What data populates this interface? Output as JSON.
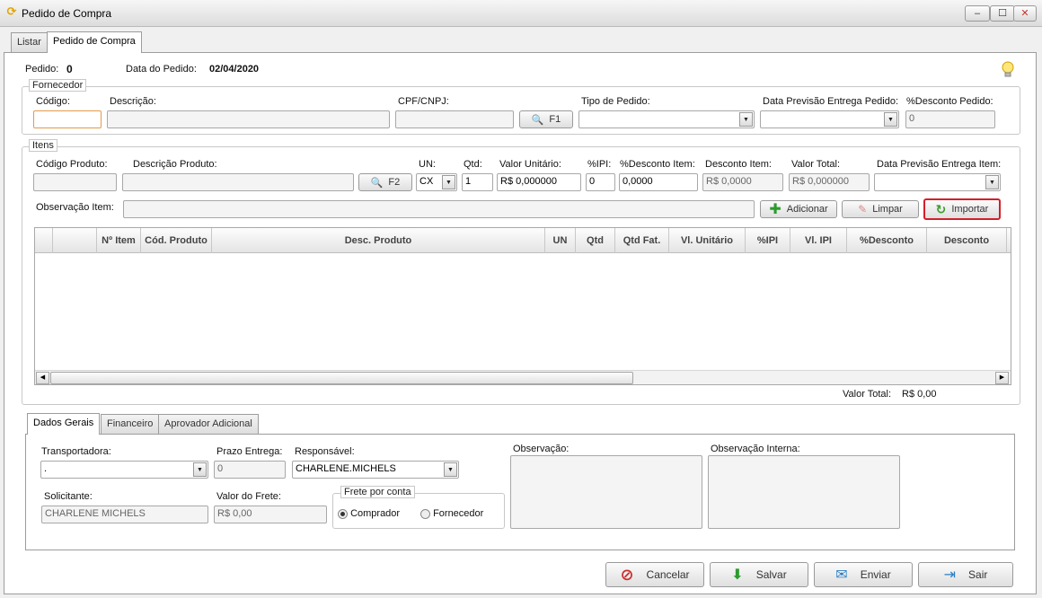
{
  "window": {
    "title": "Pedido de Compra"
  },
  "tabs": [
    {
      "label": "Listar"
    },
    {
      "label": "Pedido de Compra"
    }
  ],
  "header": {
    "pedido_label": "Pedido:",
    "pedido_value": "0",
    "data_label": "Data do Pedido:",
    "data_value": "02/04/2020"
  },
  "fornecedor": {
    "legend": "Fornecedor",
    "codigo_label": "Código:",
    "codigo_value": "",
    "descricao_label": "Descrição:",
    "descricao_value": "",
    "cpf_label": "CPF/CNPJ:",
    "cpf_value": "",
    "f1_label": "F1",
    "tipo_label": "Tipo de Pedido:",
    "tipo_value": "",
    "previsao_label": "Data Previsão Entrega Pedido:",
    "previsao_value": "",
    "desconto_label": "%Desconto Pedido:",
    "desconto_value": "0"
  },
  "itens": {
    "legend": "Itens",
    "cod_label": "Código Produto:",
    "cod_value": "",
    "desc_label": "Descrição Produto:",
    "desc_value": "",
    "f2_label": "F2",
    "un_label": "UN:",
    "un_value": "CX",
    "qtd_label": "Qtd:",
    "qtd_value": "1",
    "vu_label": "Valor Unitário:",
    "vu_value": "R$ 0,000000",
    "ipi_label": "%IPI:",
    "ipi_value": "0",
    "pdesc_label": "%Desconto Item:",
    "pdesc_value": "0,0000",
    "vdesc_label": "Desconto Item:",
    "vdesc_value": "R$ 0,0000",
    "vt_label": "Valor Total:",
    "vt_value": "R$ 0,000000",
    "prev_label": "Data Previsão Entrega Item:",
    "prev_value": "",
    "obs_label": "Observação Item:",
    "obs_value": "",
    "btn_adicionar": "Adicionar",
    "btn_limpar": "Limpar",
    "btn_importar": "Importar"
  },
  "grid": {
    "columns": [
      "Nº Item",
      "Cód. Produto",
      "Desc. Produto",
      "UN",
      "Qtd",
      "Qtd Fat.",
      "Vl. Unitário",
      "%IPI",
      "Vl. IPI",
      "%Desconto",
      "Desconto"
    ],
    "rows": []
  },
  "totals": {
    "label": "Valor Total:",
    "value": "R$ 0,00"
  },
  "bottom_tabs": [
    {
      "label": "Dados Gerais"
    },
    {
      "label": "Financeiro"
    },
    {
      "label": "Aprovador Adicional"
    }
  ],
  "dados_gerais": {
    "transp_label": "Transportadora:",
    "transp_value": ".",
    "prazo_label": "Prazo Entrega:",
    "prazo_value": "0",
    "resp_label": "Responsável:",
    "resp_value": "CHARLENE.MICHELS",
    "obs_label": "Observação:",
    "obs_int_label": "Observação Interna:",
    "solic_label": "Solicitante:",
    "solic_value": "CHARLENE MICHELS",
    "frete_label": "Valor do Frete:",
    "frete_value": "R$ 0,00",
    "frete_conta_legend": "Frete por conta",
    "opt_comprador": "Comprador",
    "opt_fornecedor": "Fornecedor",
    "selected": "Comprador"
  },
  "actions": {
    "cancelar": "Cancelar",
    "salvar": "Salvar",
    "enviar": "Enviar",
    "sair": "Sair"
  }
}
